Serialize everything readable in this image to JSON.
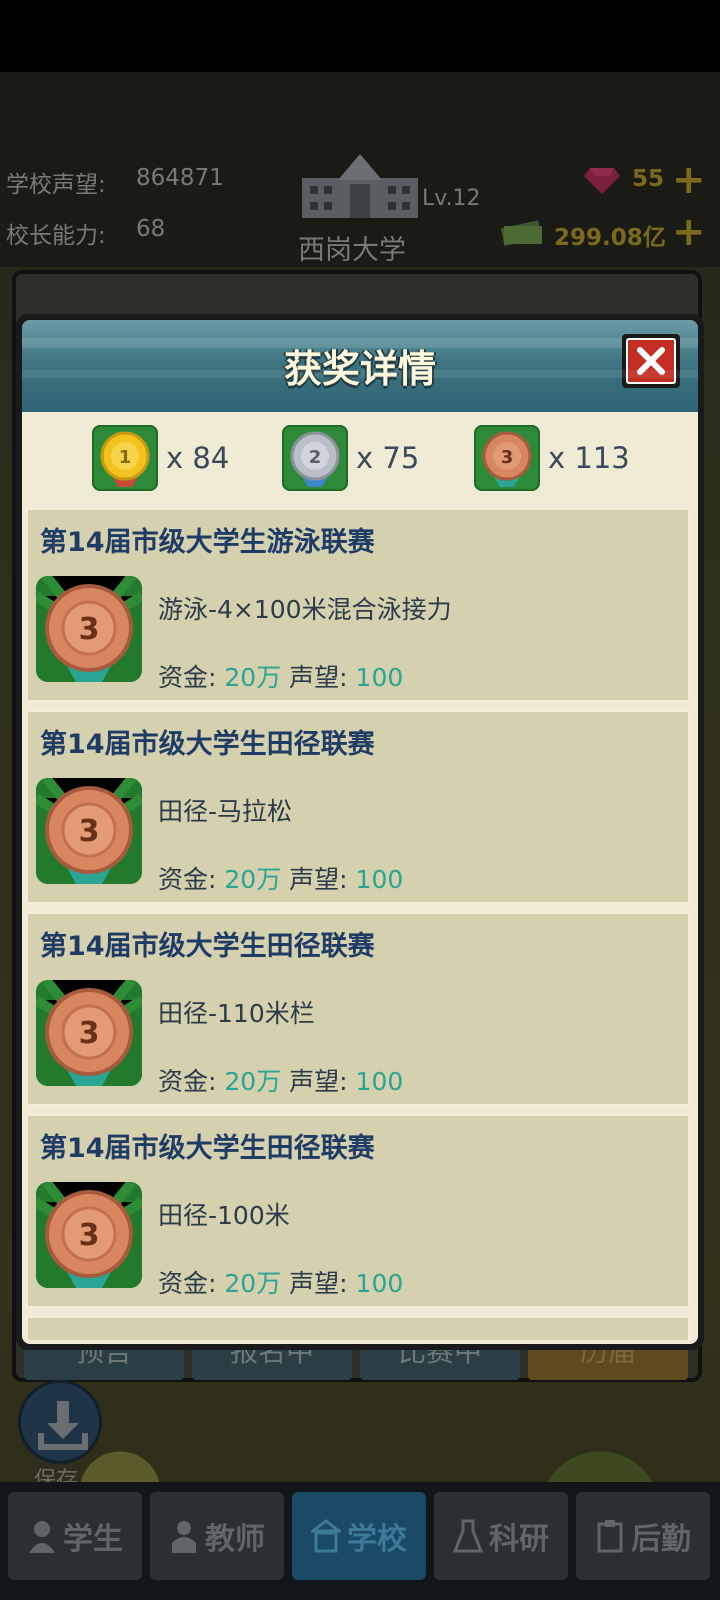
{
  "hud": {
    "reputation_label": "学校声望:",
    "reputation_value": "864871",
    "ability_label": "校长能力:",
    "ability_value": "68",
    "school_level": "Lv.12",
    "school_name": "西岗大学",
    "gems": "55",
    "money": "299.08亿"
  },
  "back_tabs": [
    "预告",
    "报名中",
    "比赛中",
    "历届"
  ],
  "save_label": "保存",
  "nav": [
    "学生",
    "教师",
    "学校",
    "科研",
    "后勤"
  ],
  "dialog": {
    "title": "获奖详情",
    "gold_count": "x 84",
    "silver_count": "x 75",
    "bronze_count": "x 113",
    "medal_numbers": {
      "gold": "1",
      "silver": "2",
      "bronze": "3"
    },
    "colors": {
      "gold": "#f4c21f",
      "silver": "#b9bfc7",
      "bronze": "#d88660",
      "badge_green": "#2d8a38"
    }
  },
  "awards": [
    {
      "title": "第14届市级大学生游泳联赛",
      "event": "游泳-4×100米混合泳接力",
      "funds_label": "资金:",
      "funds": "20万",
      "rep_label": "声望:",
      "rep": "100",
      "rank": "3"
    },
    {
      "title": "第14届市级大学生田径联赛",
      "event": "田径-马拉松",
      "funds_label": "资金:",
      "funds": "20万",
      "rep_label": "声望:",
      "rep": "100",
      "rank": "3"
    },
    {
      "title": "第14届市级大学生田径联赛",
      "event": "田径-110米栏",
      "funds_label": "资金:",
      "funds": "20万",
      "rep_label": "声望:",
      "rep": "100",
      "rank": "3"
    },
    {
      "title": "第14届市级大学生田径联赛",
      "event": "田径-100米",
      "funds_label": "资金:",
      "funds": "20万",
      "rep_label": "声望:",
      "rep": "100",
      "rank": "3"
    }
  ]
}
